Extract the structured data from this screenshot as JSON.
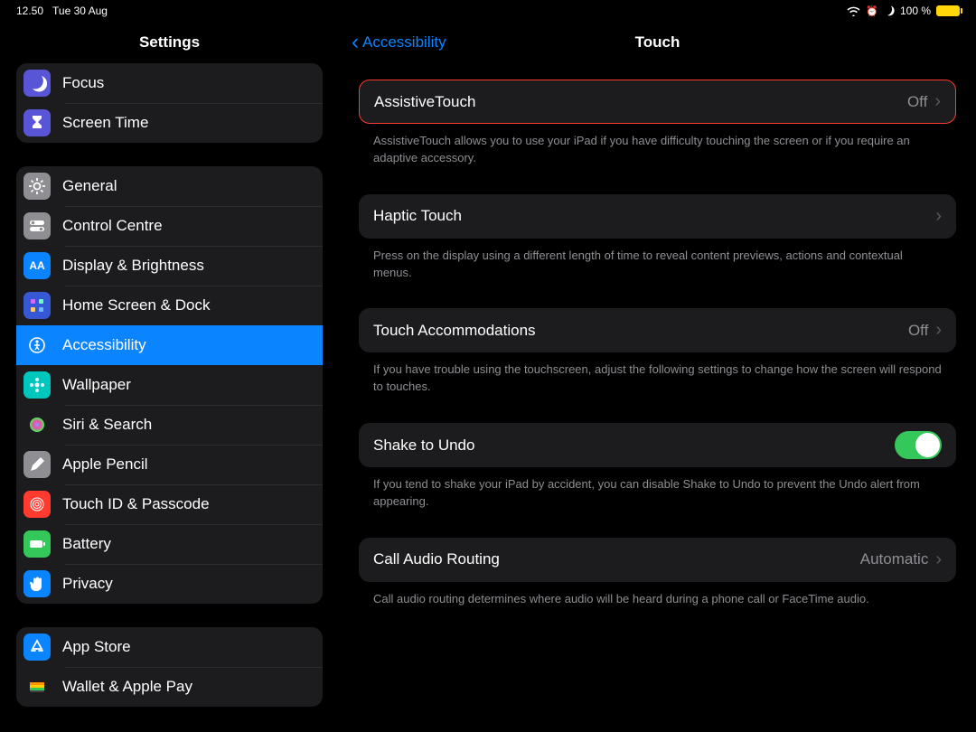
{
  "status": {
    "time": "12.50",
    "date": "Tue 30 Aug",
    "battery_pct": "100 %"
  },
  "sidebar": {
    "title": "Settings",
    "g1": [
      {
        "label": "Focus",
        "icon": "moon",
        "bg": "#5856d6"
      },
      {
        "label": "Screen Time",
        "icon": "hourglass",
        "bg": "#5856d6"
      }
    ],
    "g2": [
      {
        "label": "General",
        "icon": "gear",
        "bg": "#8e8e93"
      },
      {
        "label": "Control Centre",
        "icon": "switches",
        "bg": "#8e8e93"
      },
      {
        "label": "Display & Brightness",
        "icon": "aa",
        "bg": "#0a84ff"
      },
      {
        "label": "Home Screen & Dock",
        "icon": "grid",
        "bg": "#3758d6"
      },
      {
        "label": "Accessibility",
        "icon": "person",
        "bg": "#0a84ff",
        "selected": true
      },
      {
        "label": "Wallpaper",
        "icon": "flower",
        "bg": "#00c7be"
      },
      {
        "label": "Siri & Search",
        "icon": "siri",
        "bg": "#1c1c1e"
      },
      {
        "label": "Apple Pencil",
        "icon": "pencil",
        "bg": "#8e8e93"
      },
      {
        "label": "Touch ID & Passcode",
        "icon": "finger",
        "bg": "#ff3b30"
      },
      {
        "label": "Battery",
        "icon": "battery",
        "bg": "#34c759"
      },
      {
        "label": "Privacy",
        "icon": "hand",
        "bg": "#0a84ff"
      }
    ],
    "g3": [
      {
        "label": "App Store",
        "icon": "appstore",
        "bg": "#0a84ff"
      },
      {
        "label": "Wallet & Apple Pay",
        "icon": "wallet",
        "bg": "#1c1c1e"
      }
    ]
  },
  "main": {
    "back": "Accessibility",
    "title": "Touch",
    "cells": [
      {
        "label": "AssistiveTouch",
        "value": "Off",
        "hl": true,
        "footer": "AssistiveTouch allows you to use your iPad if you have difficulty touching the screen or if you require an adaptive accessory."
      },
      {
        "label": "Haptic Touch",
        "value": "",
        "footer": "Press on the display using a different length of time to reveal content previews, actions and contextual menus."
      },
      {
        "label": "Touch Accommodations",
        "value": "Off",
        "footer": "If you have trouble using the touchscreen, adjust the following settings to change how the screen will respond to touches."
      },
      {
        "label": "Shake to Undo",
        "toggle": true,
        "footer": "If you tend to shake your iPad by accident, you can disable Shake to Undo to prevent the Undo alert from appearing."
      },
      {
        "label": "Call Audio Routing",
        "value": "Automatic",
        "footer": "Call audio routing determines where audio will be heard during a phone call or FaceTime audio."
      }
    ]
  }
}
